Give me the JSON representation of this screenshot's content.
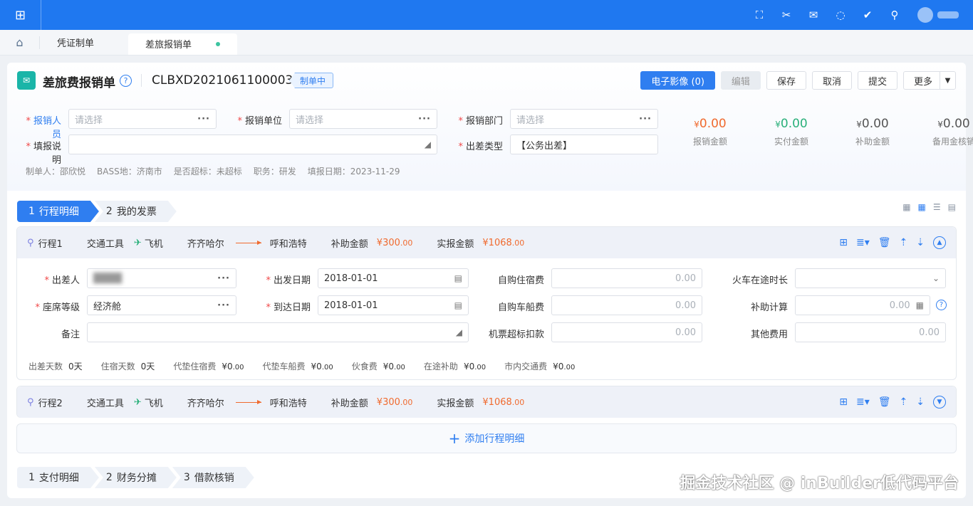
{
  "topbar": {
    "icons": [
      "apps-icon",
      "fullscreen-icon",
      "tools-icon",
      "mail-icon",
      "chat-icon",
      "check-circle-icon",
      "user-key-icon"
    ]
  },
  "tabs": {
    "items": [
      {
        "label": "凭证制单"
      },
      {
        "label": "差旅报销单"
      }
    ]
  },
  "header": {
    "icon_glyph": "✉",
    "title": "差旅费报销单",
    "doc_no": "CLBXD2021061100003",
    "status": "制单中",
    "buttons": {
      "image": "电子影像 (0)",
      "edit": "编辑",
      "save": "保存",
      "cancel": "取消",
      "submit": "提交",
      "more": "更多"
    }
  },
  "form": {
    "reimburser_label": "报销人员",
    "unit_label": "报销单位",
    "dept_label": "报销部门",
    "desc_label": "填报说明",
    "trip_type_label": "出差类型",
    "placeholder": "请选择",
    "trip_type_value": "【公务出差】"
  },
  "amounts": [
    {
      "currency": "¥",
      "value": "0.00",
      "label": "报销金额",
      "color": "#f06a2e"
    },
    {
      "currency": "¥",
      "value": "0.00",
      "label": "实付金额",
      "color": "#2ab07a"
    },
    {
      "currency": "¥",
      "value": "0.00",
      "label": "补助金额",
      "color": "#555555"
    },
    {
      "currency": "¥",
      "value": "0.00",
      "label": "备用金核销",
      "color": "#555555"
    }
  ],
  "meta": {
    "maker": "制单人：邵欣悦",
    "bass": "BASS地：济南市",
    "over": "是否超标：未超标",
    "duty": "职务：研发",
    "date": "填报日期：2023-11-29"
  },
  "steps_top": [
    {
      "n": "1",
      "label": "行程明细"
    },
    {
      "n": "2",
      "label": "我的发票"
    }
  ],
  "trip1": {
    "name": "行程1",
    "transport_label": "交通工具",
    "transport": "飞机",
    "from": "齐齐哈尔",
    "to": "呼和浩特",
    "subsidy_label": "补助金额",
    "subsidy": "¥300",
    "subsidy_dec": ".00",
    "real_label": "实报金额",
    "real": "¥1068",
    "real_dec": ".00",
    "fields": {
      "traveler": "出差人",
      "depart_date": "出发日期",
      "depart_value": "2018-01-01",
      "self_hotel": "自购住宿费",
      "train_time": "火车在途时长",
      "seat": "座席等级",
      "seat_value": "经济舱",
      "arrive_date": "到达日期",
      "arrive_value": "2018-01-01",
      "self_car": "自购车船费",
      "subsidy_calc": "补助计算",
      "remark": "备注",
      "ticket_deduct": "机票超标扣款",
      "other": "其他费用",
      "zero": "0.00"
    },
    "summary": [
      {
        "label": "出差天数",
        "value": "0天"
      },
      {
        "label": "住宿天数",
        "value": "0天"
      },
      {
        "label": "代垫住宿费",
        "value": "¥0",
        "dec": ".00"
      },
      {
        "label": "代垫车船费",
        "value": "¥0",
        "dec": ".00"
      },
      {
        "label": "伙食费",
        "value": "¥0",
        "dec": ".00"
      },
      {
        "label": "在途补助",
        "value": "¥0",
        "dec": ".00"
      },
      {
        "label": "市内交通费",
        "value": "¥0",
        "dec": ".00"
      }
    ]
  },
  "trip2": {
    "name": "行程2",
    "transport_label": "交通工具",
    "transport": "飞机",
    "from": "齐齐哈尔",
    "to": "呼和浩特",
    "subsidy_label": "补助金额",
    "subsidy": "¥300",
    "subsidy_dec": ".00",
    "real_label": "实报金额",
    "real": "¥1068",
    "real_dec": ".00"
  },
  "add_trip": "添加行程明细",
  "steps_bottom": [
    {
      "n": "1",
      "label": "支付明细"
    },
    {
      "n": "2",
      "label": "财务分摊"
    },
    {
      "n": "3",
      "label": "借款核销"
    }
  ],
  "watermark": "掘金技术社区 @ inBuilder低代码平台"
}
